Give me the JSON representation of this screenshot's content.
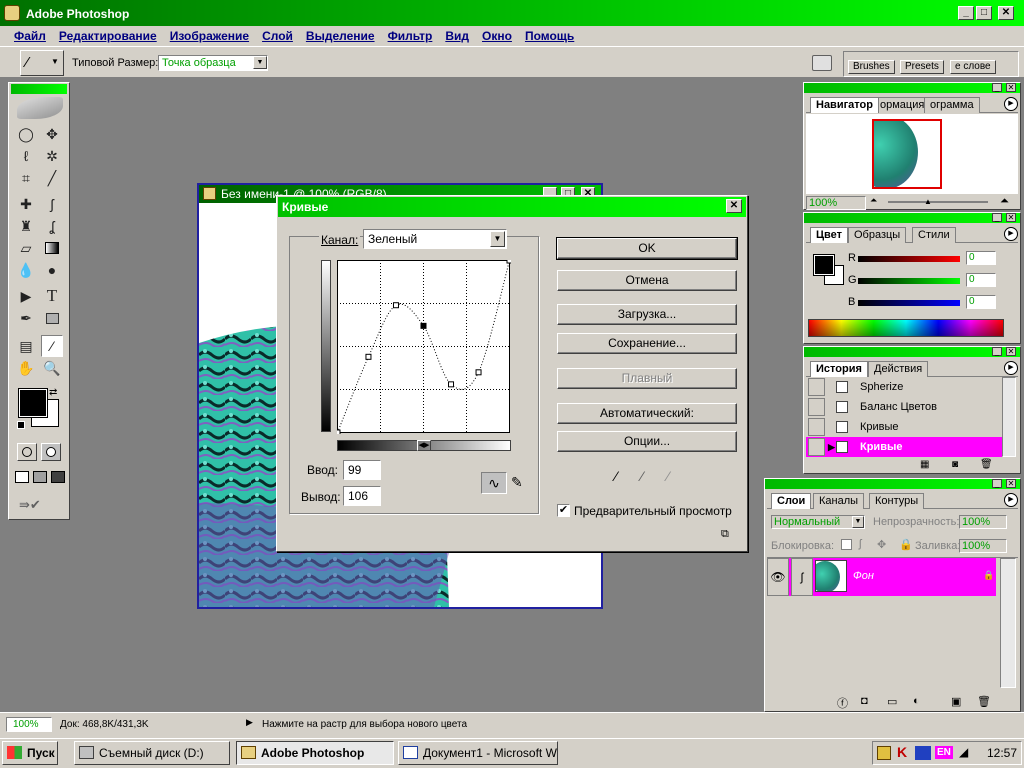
{
  "app": {
    "title": "Adobe Photoshop"
  },
  "menu": [
    "Файл",
    "Редактирование",
    "Изображение",
    "Слой",
    "Выделение",
    "Фильтр",
    "Вид",
    "Окно",
    "Помощь"
  ],
  "options": {
    "size_label": "Типовой Размер:",
    "size_value": "Точка образца"
  },
  "palette_well": {
    "tabs": [
      "Brushes",
      "Presets",
      "е слове"
    ]
  },
  "document": {
    "title": "Без имени-1 @ 100% (RGB/8)"
  },
  "curves": {
    "title": "Кривые",
    "channel_label": "Канал:",
    "channel_value": "Зеленый",
    "input_label": "Ввод:",
    "input_value": "99",
    "output_label": "Вывод:",
    "output_value": "106",
    "buttons": {
      "ok": "OK",
      "cancel": "Отмена",
      "load": "Загрузка...",
      "save": "Сохранение...",
      "smooth": "Плавный",
      "auto": "Автоматический:",
      "options": "Опции..."
    },
    "preview_label": "Предварительный просмотр",
    "preview_checked": true,
    "points": [
      [
        0,
        0
      ],
      [
        18,
        44
      ],
      [
        34,
        74
      ],
      [
        50,
        62
      ],
      [
        66,
        28
      ],
      [
        82,
        35
      ],
      [
        100,
        100
      ]
    ]
  },
  "navigator": {
    "tabs": [
      "Навигатор",
      "ормация",
      "ограмма"
    ],
    "zoom": "100%"
  },
  "color": {
    "tabs": [
      "Цвет",
      "Образцы",
      "Стили"
    ],
    "r_label": "R",
    "g_label": "G",
    "b_label": "B",
    "r": "0",
    "g": "0",
    "b": "0"
  },
  "history": {
    "tabs": [
      "История",
      "Действия"
    ],
    "items": [
      "Spherize",
      "Баланс Цветов",
      "Кривые",
      "Кривые"
    ]
  },
  "layers": {
    "tabs": [
      "Слои",
      "Каналы",
      "Контуры"
    ],
    "mode": "Нормальный",
    "opacity_label": "Непрозрачность:",
    "opacity": "100%",
    "lock_label": "Блокировка:",
    "fill_label": "Заливка:",
    "fill": "100%",
    "layer_name": "Фон"
  },
  "status": {
    "zoom": "100%",
    "doc": "Док: 468,8K/431,3K",
    "hint": "Нажмите на растр для выбора нового цвета"
  },
  "taskbar": {
    "start": "Пуск",
    "tasks": [
      "Съемный диск (D:)",
      "Adobe Photoshop",
      "Документ1 - Microsoft W..."
    ],
    "lang": "EN",
    "clock": "12:57"
  },
  "colors": {
    "title_green": "#00ff00",
    "highlight_magenta": "#ff00ff",
    "desk_gray": "#808080"
  }
}
